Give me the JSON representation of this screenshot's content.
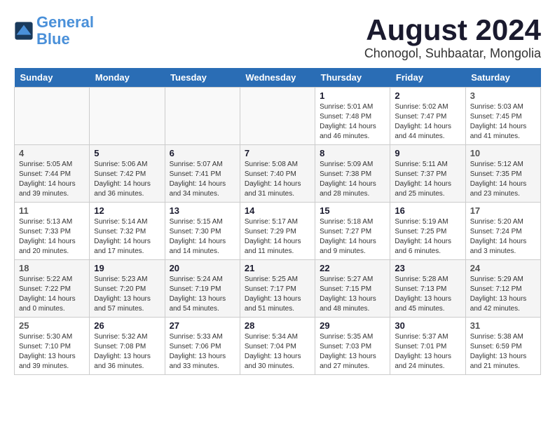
{
  "header": {
    "logo_line1": "General",
    "logo_line2": "Blue",
    "month_year": "August 2024",
    "location": "Chonogol, Suhbaatar, Mongolia"
  },
  "weekdays": [
    "Sunday",
    "Monday",
    "Tuesday",
    "Wednesday",
    "Thursday",
    "Friday",
    "Saturday"
  ],
  "weeks": [
    [
      {
        "day": "",
        "info": ""
      },
      {
        "day": "",
        "info": ""
      },
      {
        "day": "",
        "info": ""
      },
      {
        "day": "",
        "info": ""
      },
      {
        "day": "1",
        "info": "Sunrise: 5:01 AM\nSunset: 7:48 PM\nDaylight: 14 hours\nand 46 minutes."
      },
      {
        "day": "2",
        "info": "Sunrise: 5:02 AM\nSunset: 7:47 PM\nDaylight: 14 hours\nand 44 minutes."
      },
      {
        "day": "3",
        "info": "Sunrise: 5:03 AM\nSunset: 7:45 PM\nDaylight: 14 hours\nand 41 minutes."
      }
    ],
    [
      {
        "day": "4",
        "info": "Sunrise: 5:05 AM\nSunset: 7:44 PM\nDaylight: 14 hours\nand 39 minutes."
      },
      {
        "day": "5",
        "info": "Sunrise: 5:06 AM\nSunset: 7:42 PM\nDaylight: 14 hours\nand 36 minutes."
      },
      {
        "day": "6",
        "info": "Sunrise: 5:07 AM\nSunset: 7:41 PM\nDaylight: 14 hours\nand 34 minutes."
      },
      {
        "day": "7",
        "info": "Sunrise: 5:08 AM\nSunset: 7:40 PM\nDaylight: 14 hours\nand 31 minutes."
      },
      {
        "day": "8",
        "info": "Sunrise: 5:09 AM\nSunset: 7:38 PM\nDaylight: 14 hours\nand 28 minutes."
      },
      {
        "day": "9",
        "info": "Sunrise: 5:11 AM\nSunset: 7:37 PM\nDaylight: 14 hours\nand 25 minutes."
      },
      {
        "day": "10",
        "info": "Sunrise: 5:12 AM\nSunset: 7:35 PM\nDaylight: 14 hours\nand 23 minutes."
      }
    ],
    [
      {
        "day": "11",
        "info": "Sunrise: 5:13 AM\nSunset: 7:33 PM\nDaylight: 14 hours\nand 20 minutes."
      },
      {
        "day": "12",
        "info": "Sunrise: 5:14 AM\nSunset: 7:32 PM\nDaylight: 14 hours\nand 17 minutes."
      },
      {
        "day": "13",
        "info": "Sunrise: 5:15 AM\nSunset: 7:30 PM\nDaylight: 14 hours\nand 14 minutes."
      },
      {
        "day": "14",
        "info": "Sunrise: 5:17 AM\nSunset: 7:29 PM\nDaylight: 14 hours\nand 11 minutes."
      },
      {
        "day": "15",
        "info": "Sunrise: 5:18 AM\nSunset: 7:27 PM\nDaylight: 14 hours\nand 9 minutes."
      },
      {
        "day": "16",
        "info": "Sunrise: 5:19 AM\nSunset: 7:25 PM\nDaylight: 14 hours\nand 6 minutes."
      },
      {
        "day": "17",
        "info": "Sunrise: 5:20 AM\nSunset: 7:24 PM\nDaylight: 14 hours\nand 3 minutes."
      }
    ],
    [
      {
        "day": "18",
        "info": "Sunrise: 5:22 AM\nSunset: 7:22 PM\nDaylight: 14 hours\nand 0 minutes."
      },
      {
        "day": "19",
        "info": "Sunrise: 5:23 AM\nSunset: 7:20 PM\nDaylight: 13 hours\nand 57 minutes."
      },
      {
        "day": "20",
        "info": "Sunrise: 5:24 AM\nSunset: 7:19 PM\nDaylight: 13 hours\nand 54 minutes."
      },
      {
        "day": "21",
        "info": "Sunrise: 5:25 AM\nSunset: 7:17 PM\nDaylight: 13 hours\nand 51 minutes."
      },
      {
        "day": "22",
        "info": "Sunrise: 5:27 AM\nSunset: 7:15 PM\nDaylight: 13 hours\nand 48 minutes."
      },
      {
        "day": "23",
        "info": "Sunrise: 5:28 AM\nSunset: 7:13 PM\nDaylight: 13 hours\nand 45 minutes."
      },
      {
        "day": "24",
        "info": "Sunrise: 5:29 AM\nSunset: 7:12 PM\nDaylight: 13 hours\nand 42 minutes."
      }
    ],
    [
      {
        "day": "25",
        "info": "Sunrise: 5:30 AM\nSunset: 7:10 PM\nDaylight: 13 hours\nand 39 minutes."
      },
      {
        "day": "26",
        "info": "Sunrise: 5:32 AM\nSunset: 7:08 PM\nDaylight: 13 hours\nand 36 minutes."
      },
      {
        "day": "27",
        "info": "Sunrise: 5:33 AM\nSunset: 7:06 PM\nDaylight: 13 hours\nand 33 minutes."
      },
      {
        "day": "28",
        "info": "Sunrise: 5:34 AM\nSunset: 7:04 PM\nDaylight: 13 hours\nand 30 minutes."
      },
      {
        "day": "29",
        "info": "Sunrise: 5:35 AM\nSunset: 7:03 PM\nDaylight: 13 hours\nand 27 minutes."
      },
      {
        "day": "30",
        "info": "Sunrise: 5:37 AM\nSunset: 7:01 PM\nDaylight: 13 hours\nand 24 minutes."
      },
      {
        "day": "31",
        "info": "Sunrise: 5:38 AM\nSunset: 6:59 PM\nDaylight: 13 hours\nand 21 minutes."
      }
    ]
  ]
}
